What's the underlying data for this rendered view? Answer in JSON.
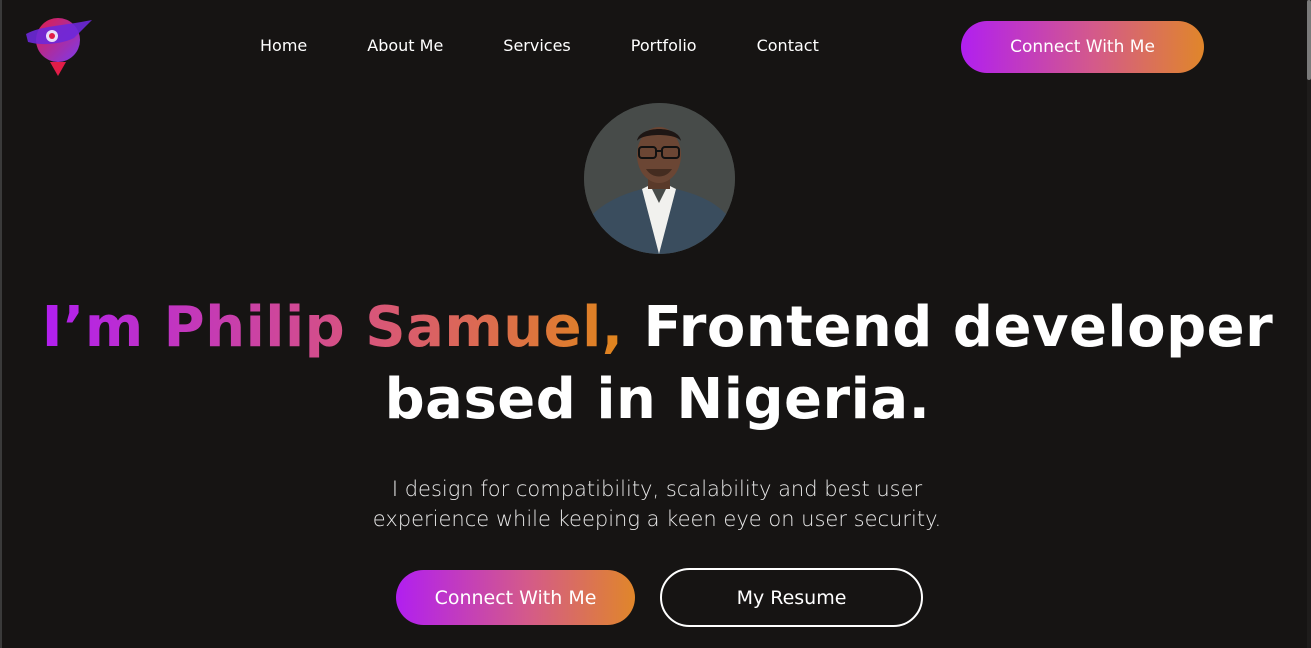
{
  "logo": {
    "icon": "rocket-planet-logo-icon",
    "colors": [
      "#e11d48",
      "#7c3aed"
    ]
  },
  "nav": {
    "links": [
      "Home",
      "About Me",
      "Services",
      "Portfolio",
      "Contact"
    ],
    "cta_label": "Connect With Me"
  },
  "hero": {
    "avatar": "profile-photo",
    "title_highlight": "I’m Philip Samuel,",
    "title_rest": " Frontend developer based in Nigeria.",
    "subtitle": "I design for compatibility, scalability and best user experience while keeping a keen eye on user security.",
    "primary_label": "Connect With Me",
    "secondary_label": "My Resume"
  },
  "colors": {
    "background": "#161413",
    "gradient_start": "#b11ff0",
    "gradient_end": "#e0862a"
  }
}
